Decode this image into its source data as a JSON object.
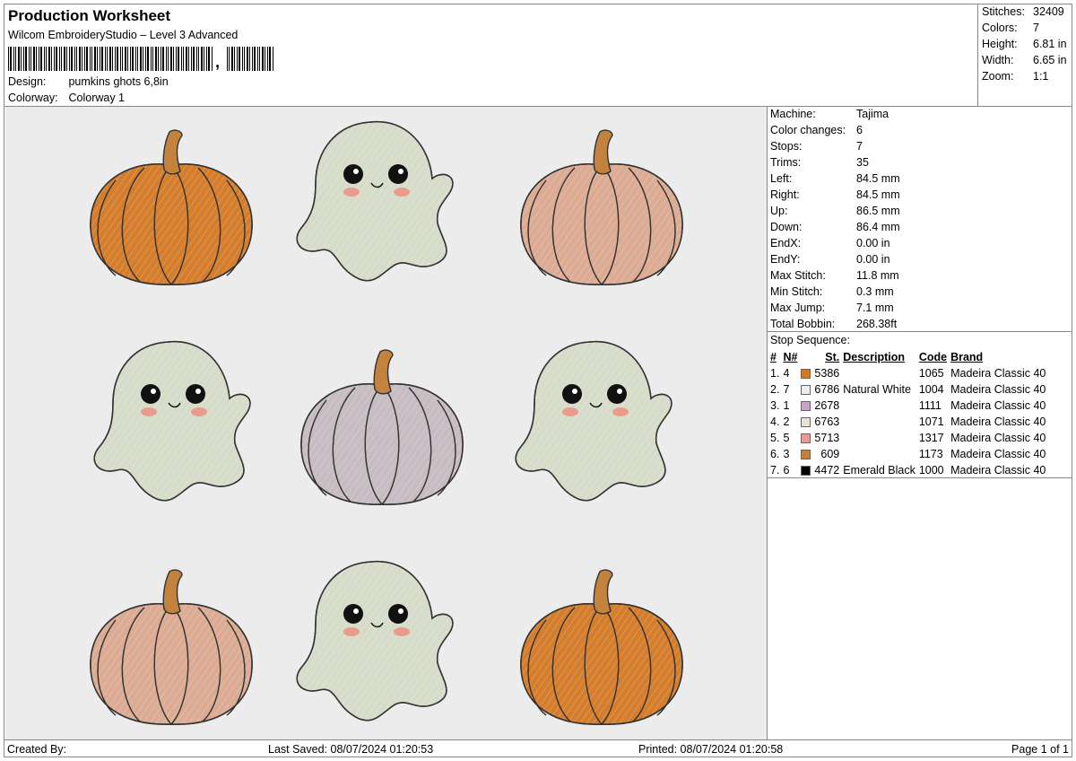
{
  "header": {
    "title": "Production Worksheet",
    "software": "Wilcom EmbroideryStudio – Level 3 Advanced",
    "barcode_text": ",",
    "design_label": "Design:",
    "design_value": "pumkins ghots 6,8in",
    "colorway_label": "Colorway:",
    "colorway_value": "Colorway 1"
  },
  "stats": [
    {
      "label": "Stitches:",
      "value": "32409"
    },
    {
      "label": "Colors:",
      "value": "7"
    },
    {
      "label": "Height:",
      "value": "6.81 in"
    },
    {
      "label": "Width:",
      "value": "6.65 in"
    },
    {
      "label": "Zoom:",
      "value": "1:1"
    }
  ],
  "machine_info": [
    {
      "label": "Machine:",
      "value": "Tajima"
    },
    {
      "label": "Color changes:",
      "value": "6"
    },
    {
      "label": "Stops:",
      "value": "7"
    },
    {
      "label": "Trims:",
      "value": "35"
    },
    {
      "label": "Left:",
      "value": "84.5 mm"
    },
    {
      "label": "Right:",
      "value": "84.5 mm"
    },
    {
      "label": "Up:",
      "value": "86.5 mm"
    },
    {
      "label": "Down:",
      "value": "86.4 mm"
    },
    {
      "label": "EndX:",
      "value": "0.00 in"
    },
    {
      "label": "EndY:",
      "value": "0.00 in"
    },
    {
      "label": "Max Stitch:",
      "value": "11.8 mm"
    },
    {
      "label": "Min Stitch:",
      "value": "0.3 mm"
    },
    {
      "label": "Max Jump:",
      "value": "7.1 mm"
    },
    {
      "label": "Total Bobbin:",
      "value": "268.38ft"
    }
  ],
  "stop_sequence": {
    "title": "Stop Sequence:",
    "headers": [
      "#",
      "N#",
      "St.",
      "Description",
      "Code",
      "Brand"
    ],
    "rows": [
      {
        "idx": "1.",
        "n": "4",
        "color": "#d2782a",
        "st": "5386",
        "desc": "",
        "code": "1065",
        "brand": "Madeira Classic 40"
      },
      {
        "idx": "2.",
        "n": "7",
        "color": "#eceef2",
        "st": "6786",
        "desc": "Natural White",
        "code": "1004",
        "brand": "Madeira Classic 40"
      },
      {
        "idx": "3.",
        "n": "1",
        "color": "#c7a4c6",
        "st": "2678",
        "desc": "",
        "code": "1111",
        "brand": "Madeira Classic 40"
      },
      {
        "idx": "4.",
        "n": "2",
        "color": "#e9e3d6",
        "st": "6763",
        "desc": "",
        "code": "1071",
        "brand": "Madeira Classic 40"
      },
      {
        "idx": "5.",
        "n": "5",
        "color": "#e79a98",
        "st": "5713",
        "desc": "",
        "code": "1317",
        "brand": "Madeira Classic 40"
      },
      {
        "idx": "6.",
        "n": "3",
        "color": "#c5803f",
        "st": "609",
        "desc": "",
        "code": "1173",
        "brand": "Madeira Classic 40"
      },
      {
        "idx": "7.",
        "n": "6",
        "color": "#000000",
        "st": "4472",
        "desc": "Emerald Black",
        "code": "1000",
        "brand": "Madeira Classic 40"
      }
    ]
  },
  "design_colors": {
    "orange_pumpkin": "#d47d2c",
    "pink_pumpkin": "#dcab93",
    "grey_pumpkin": "#c6bcc1",
    "ghost": "#d6dcc9",
    "stem": "#c3823e",
    "blush": "#e99c8c"
  },
  "footer": {
    "created_by": "Created By:",
    "last_saved": "Last Saved: 08/07/2024 01:20:53",
    "printed": "Printed: 08/07/2024 01:20:58",
    "page": "Page 1 of 1"
  }
}
